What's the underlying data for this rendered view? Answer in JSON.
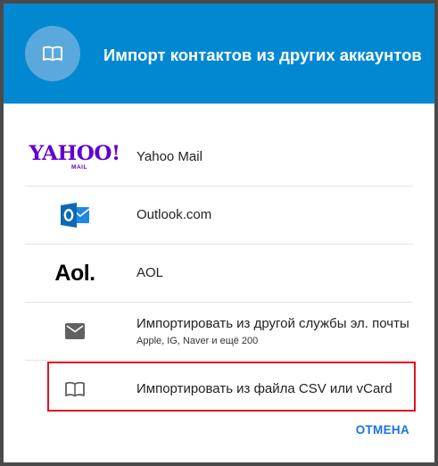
{
  "colors": {
    "header_bg": "#0288d1",
    "avatar_bg": "#5ba9dc",
    "accent": "#1a73e8",
    "yahoo": "#5f01d1",
    "outlook": "#0d68b5",
    "highlight": "#e0141f"
  },
  "header": {
    "icon": "address-book-icon",
    "title": "Импорт контактов из других аккаунтов"
  },
  "sources": [
    {
      "icon": "yahoo-logo",
      "logo_text": "YAHOO!",
      "logo_sub": "MAIL",
      "label": "Yahoo Mail"
    },
    {
      "icon": "outlook-logo",
      "logo_text": "O",
      "label": "Outlook.com"
    },
    {
      "icon": "aol-logo",
      "logo_text": "Aol.",
      "label": "AOL"
    },
    {
      "icon": "mail-icon",
      "label": "Импортировать из другой службы эл. почты",
      "sublabel": "Apple, IG, Naver и ещё 200"
    },
    {
      "icon": "address-book-icon",
      "label": "Импортировать из файла CSV или vCard",
      "highlighted": true
    }
  ],
  "footer": {
    "cancel_label": "ОТМЕНА"
  }
}
